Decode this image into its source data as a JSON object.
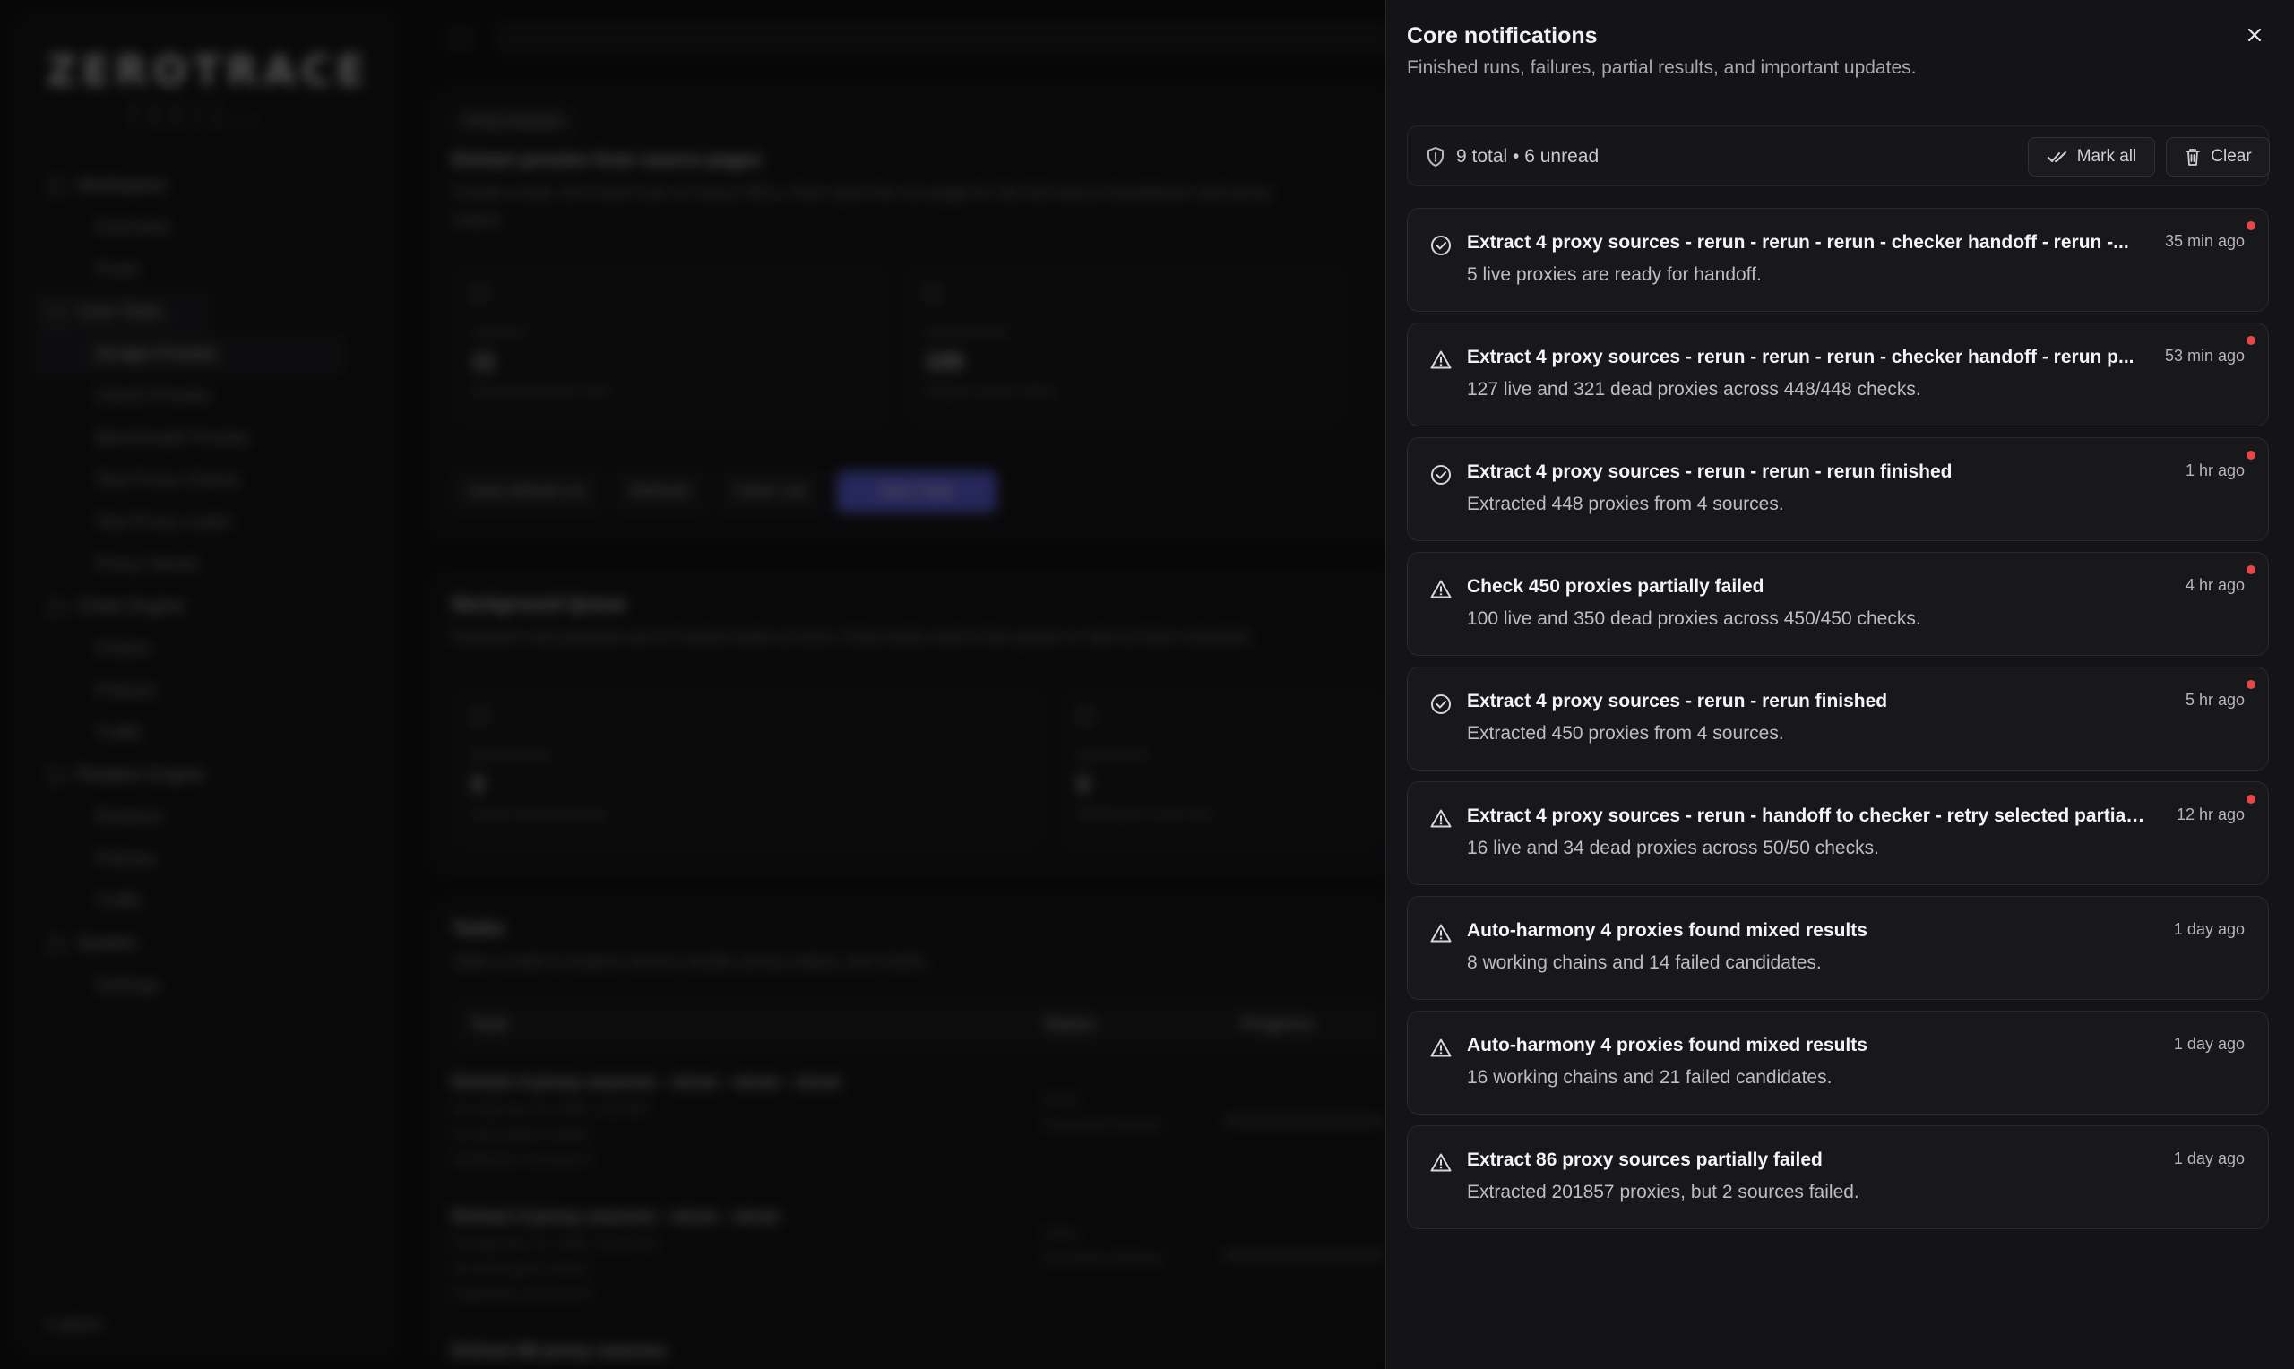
{
  "background": {
    "logo": "ZEROTRACE",
    "logo_sub": "PROXY TOOLKIT",
    "nav": [
      {
        "type": "group",
        "label": "Workspace"
      },
      {
        "type": "item",
        "label": "Overview"
      },
      {
        "type": "item",
        "label": "Pools"
      },
      {
        "type": "group",
        "label": "Core Tools",
        "active": true
      },
      {
        "type": "item",
        "label": "Scrape Proxies",
        "active": true
      },
      {
        "type": "item",
        "label": "Check Proxies"
      },
      {
        "type": "item",
        "label": "Benchmark Proxies"
      },
      {
        "type": "item",
        "label": "Test Proxy Chains"
      },
      {
        "type": "item",
        "label": "Test Proxy Leaks"
      },
      {
        "type": "item",
        "label": "Proxy Viewer"
      },
      {
        "type": "group",
        "label": "Chain Engine"
      },
      {
        "type": "item",
        "label": "Chains"
      },
      {
        "type": "item",
        "label": "Policies"
      },
      {
        "type": "item",
        "label": "Traffic"
      },
      {
        "type": "group",
        "label": "Rotation Engine"
      },
      {
        "type": "item",
        "label": "Rotators"
      },
      {
        "type": "item",
        "label": "Policies"
      },
      {
        "type": "item",
        "label": "Traffic"
      },
      {
        "type": "group",
        "label": "System"
      },
      {
        "type": "item",
        "label": "Settings"
      }
    ],
    "logout": "Logout",
    "extractor": {
      "pill": "Proxy Extractor",
      "heading": "Extract proxies from source pages",
      "desc": "Create a task, let it fetch one or many URLs, then open the run page for the full source breakdown and proxy output.",
      "stats": [
        {
          "label": "TASKS",
          "value": "11",
          "caption": "Saved extraction runs"
        },
        {
          "label": "SOURCES",
          "value": "100",
          "caption": "Unique source URLs"
        }
      ],
      "buttons": [
        "Auto-refresh on",
        "Refresh",
        "Clear List",
        "New Task"
      ]
    },
    "queue": {
      "heading": "Background Queue",
      "desc": "Extractor runs process up to 3 active tasks at once. Extra tasks wait in the queue or start at their schedule.",
      "stats": [
        {
          "label": "RUNNING",
          "value": "0",
          "caption": "Active extraction jobs"
        },
        {
          "label": "QUEUED",
          "value": "0",
          "caption": "Waiting for a free slot"
        }
      ]
    },
    "tasks": {
      "heading": "Tasks",
      "desc": "Open a task to inspect source results, proxy output, and charts.",
      "columns": [
        "Task",
        "Status",
        "Progress"
      ],
      "rows": [
        {
          "title": "Extract 4 proxy sources - rerun - rerun - rerun",
          "meta1": "No tags  Apr 15, 2026, 1:03 AM",
          "meta2": "No description added",
          "meta3": "Duplicates removed 0",
          "status": "Done",
          "status_sub": "Extraction finished"
        },
        {
          "title": "Extract 4 proxy sources - rerun - rerun",
          "meta1": "No tags  Apr 15, 2026, 10:29 PM",
          "meta2": "No description added",
          "meta3": "Duplicates removed 0",
          "status": "Done",
          "status_sub": "Extraction finished"
        },
        {
          "title": "Extract 86 proxy sources",
          "meta1": "",
          "meta2": "",
          "meta3": "",
          "status": "",
          "status_sub": ""
        }
      ]
    }
  },
  "panel": {
    "title": "Core notifications",
    "subtitle": "Finished runs, failures, partial results, and important updates.",
    "summary": "9 total • 6 unread",
    "mark_all": "Mark all",
    "clear": "Clear",
    "notifications": [
      {
        "icon": "check-circle-icon",
        "title": "Extract 4 proxy sources - rerun - rerun - rerun - checker handoff - rerun -...",
        "body": "5 live proxies are ready for handoff.",
        "time": "35 min ago",
        "unread": true
      },
      {
        "icon": "warning-triangle-icon",
        "title": "Extract 4 proxy sources - rerun - rerun - rerun - checker handoff - rerun p...",
        "body": "127 live and 321 dead proxies across 448/448 checks.",
        "time": "53 min ago",
        "unread": true
      },
      {
        "icon": "check-circle-icon",
        "title": "Extract 4 proxy sources - rerun - rerun - rerun finished",
        "body": "Extracted 448 proxies from 4 sources.",
        "time": "1 hr ago",
        "unread": true
      },
      {
        "icon": "warning-triangle-icon",
        "title": "Check 450 proxies partially failed",
        "body": "100 live and 350 dead proxies across 450/450 checks.",
        "time": "4 hr ago",
        "unread": true
      },
      {
        "icon": "check-circle-icon",
        "title": "Extract 4 proxy sources - rerun - rerun finished",
        "body": "Extracted 450 proxies from 4 sources.",
        "time": "5 hr ago",
        "unread": true
      },
      {
        "icon": "warning-triangle-icon",
        "title": "Extract 4 proxy sources - rerun - handoff to checker - retry selected partiall...",
        "body": "16 live and 34 dead proxies across 50/50 checks.",
        "time": "12 hr ago",
        "unread": true
      },
      {
        "icon": "warning-triangle-icon",
        "title": "Auto-harmony 4 proxies found mixed results",
        "body": "8 working chains and 14 failed candidates.",
        "time": "1 day ago",
        "unread": false
      },
      {
        "icon": "warning-triangle-icon",
        "title": "Auto-harmony 4 proxies found mixed results",
        "body": "16 working chains and 21 failed candidates.",
        "time": "1 day ago",
        "unread": false
      },
      {
        "icon": "warning-triangle-icon",
        "title": "Extract 86 proxy sources partially failed",
        "body": "Extracted 201857 proxies, but 2 sources failed.",
        "time": "1 day ago",
        "unread": false
      }
    ]
  }
}
